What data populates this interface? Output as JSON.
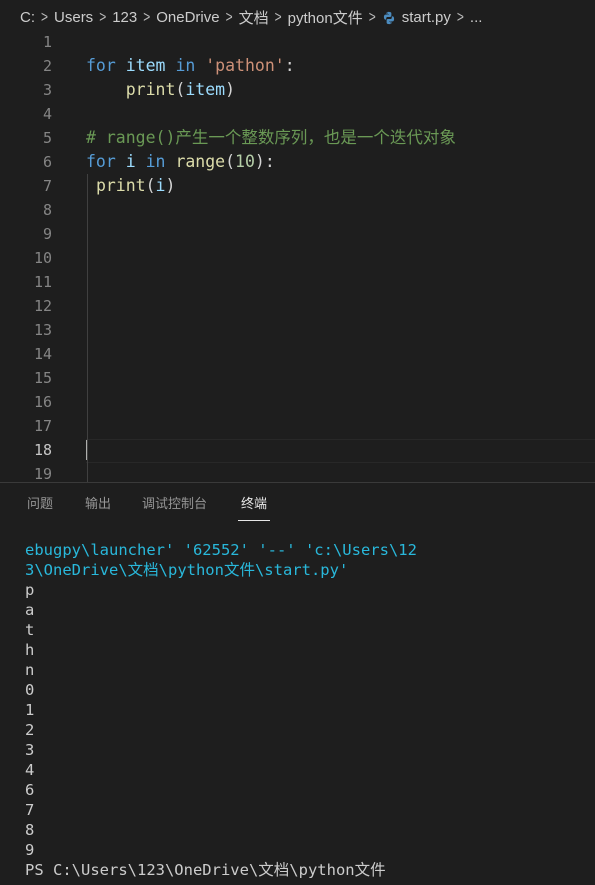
{
  "breadcrumb": {
    "items": [
      "C:",
      "Users",
      "123",
      "OneDrive",
      "文档",
      "python文件"
    ],
    "file": "start.py",
    "more": "..."
  },
  "editor": {
    "active_line": 18,
    "lines": [
      {
        "n": "1",
        "tokens": []
      },
      {
        "n": "2",
        "tokens": [
          {
            "t": "for",
            "c": "kw"
          },
          {
            "t": " "
          },
          {
            "t": "item",
            "c": "var"
          },
          {
            "t": " "
          },
          {
            "t": "in",
            "c": "kw"
          },
          {
            "t": " "
          },
          {
            "t": "'pathon'",
            "c": "str"
          },
          {
            "t": ":",
            "c": "punc"
          }
        ]
      },
      {
        "n": "3",
        "tokens": [
          {
            "t": "    "
          },
          {
            "t": "print",
            "c": "fn"
          },
          {
            "t": "(",
            "c": "punc"
          },
          {
            "t": "item",
            "c": "var"
          },
          {
            "t": ")",
            "c": "punc"
          }
        ]
      },
      {
        "n": "4",
        "tokens": []
      },
      {
        "n": "5",
        "tokens": [
          {
            "t": "# range()产生一个整数序列，也是一个迭代对象",
            "c": "cmt"
          }
        ]
      },
      {
        "n": "6",
        "tokens": [
          {
            "t": "for",
            "c": "kw"
          },
          {
            "t": " "
          },
          {
            "t": "i",
            "c": "var"
          },
          {
            "t": " "
          },
          {
            "t": "in",
            "c": "kw"
          },
          {
            "t": " "
          },
          {
            "t": "range",
            "c": "fn"
          },
          {
            "t": "(",
            "c": "punc"
          },
          {
            "t": "10",
            "c": "num"
          },
          {
            "t": "):",
            "c": "punc"
          }
        ]
      },
      {
        "n": "7",
        "tokens": [
          {
            "t": " "
          },
          {
            "t": "print",
            "c": "fn"
          },
          {
            "t": "(",
            "c": "punc"
          },
          {
            "t": "i",
            "c": "var"
          },
          {
            "t": ")",
            "c": "punc"
          }
        ]
      },
      {
        "n": "8",
        "tokens": []
      },
      {
        "n": "9",
        "tokens": []
      },
      {
        "n": "10",
        "tokens": []
      },
      {
        "n": "11",
        "tokens": []
      },
      {
        "n": "12",
        "tokens": []
      },
      {
        "n": "13",
        "tokens": []
      },
      {
        "n": "14",
        "tokens": []
      },
      {
        "n": "15",
        "tokens": []
      },
      {
        "n": "16",
        "tokens": []
      },
      {
        "n": "17",
        "tokens": []
      },
      {
        "n": "18",
        "tokens": []
      },
      {
        "n": "19",
        "tokens": []
      }
    ]
  },
  "panel": {
    "tabs": [
      "问题",
      "输出",
      "调试控制台",
      "终端"
    ],
    "active_tab": "终端"
  },
  "terminal": {
    "cmd_lines": [
      "ebugpy\\launcher' '62552' '--' 'c:\\Users\\12",
      "3\\OneDrive\\文档\\python文件\\start.py'"
    ],
    "output": [
      "p",
      "a",
      "t",
      "h",
      "n",
      "0",
      "1",
      "2",
      "3",
      "4",
      "6",
      "7",
      "8",
      "9"
    ],
    "prompt": "PS C:\\Users\\123\\OneDrive\\文档\\python文件"
  }
}
